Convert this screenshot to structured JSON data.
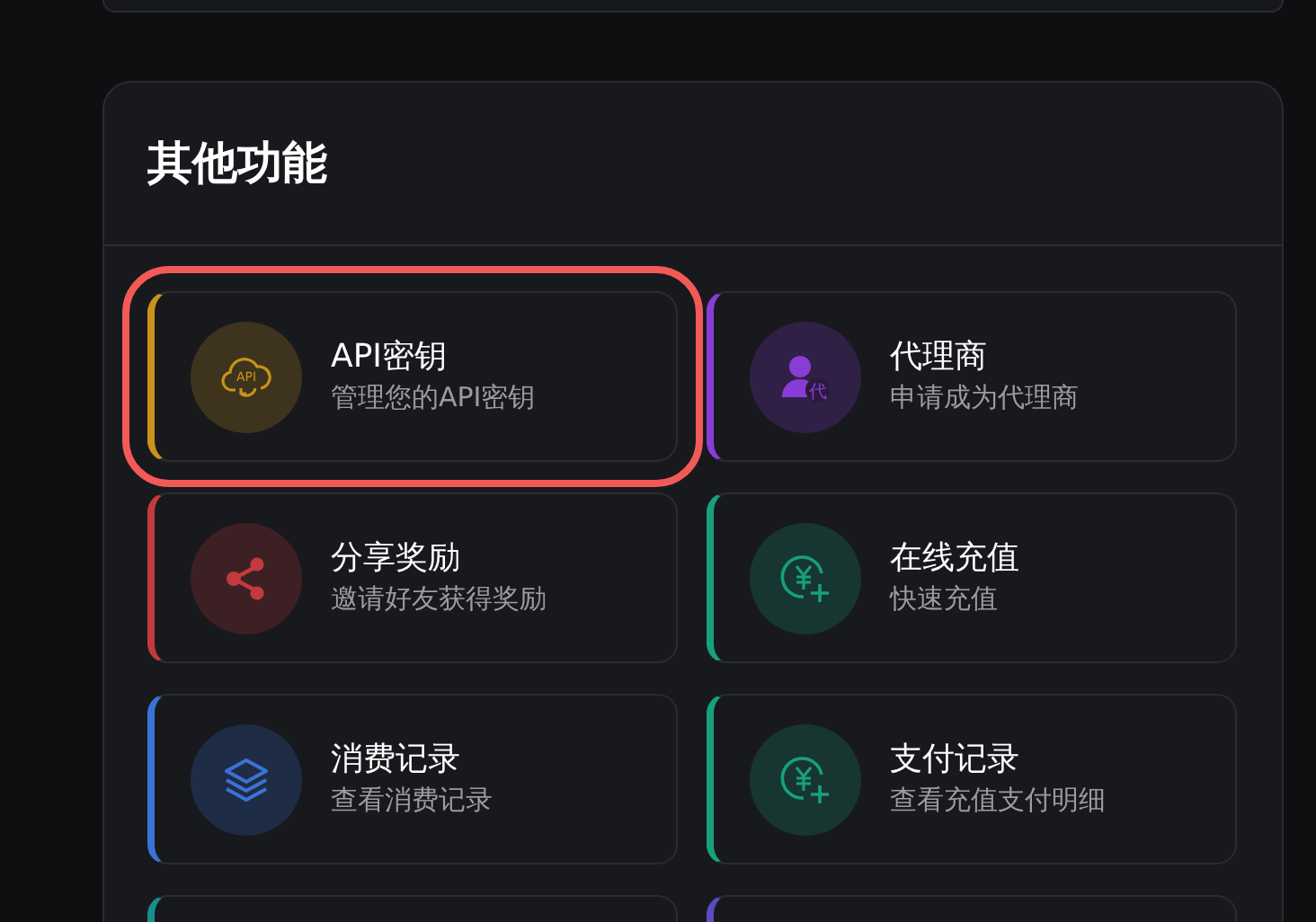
{
  "section": {
    "title": "其他功能"
  },
  "items": [
    {
      "kind": "api",
      "icon_text": "API",
      "title": "API密钥",
      "subtitle": "管理您的API密钥",
      "color": "#c8921c",
      "highlighted": true
    },
    {
      "kind": "agent",
      "icon_text": "代",
      "title": "代理商",
      "subtitle": "申请成为代理商",
      "color": "#8a3cd6",
      "highlighted": false
    },
    {
      "kind": "share",
      "title": "分享奖励",
      "subtitle": "邀请好友获得奖励",
      "color": "#c43a3c",
      "highlighted": false
    },
    {
      "kind": "recharge",
      "title": "在线充值",
      "subtitle": "快速充值",
      "color": "#17a07c",
      "highlighted": false
    },
    {
      "kind": "layers",
      "title": "消费记录",
      "subtitle": "查看消费记录",
      "color": "#3b72d6",
      "highlighted": false
    },
    {
      "kind": "recharge",
      "title": "支付记录",
      "subtitle": "查看充值支付明细",
      "color": "#17a07c",
      "highlighted": false
    },
    {
      "kind": "partial",
      "color": "#16908a",
      "highlighted": false
    },
    {
      "kind": "partial",
      "color": "#5a4bc4",
      "highlighted": false
    }
  ]
}
